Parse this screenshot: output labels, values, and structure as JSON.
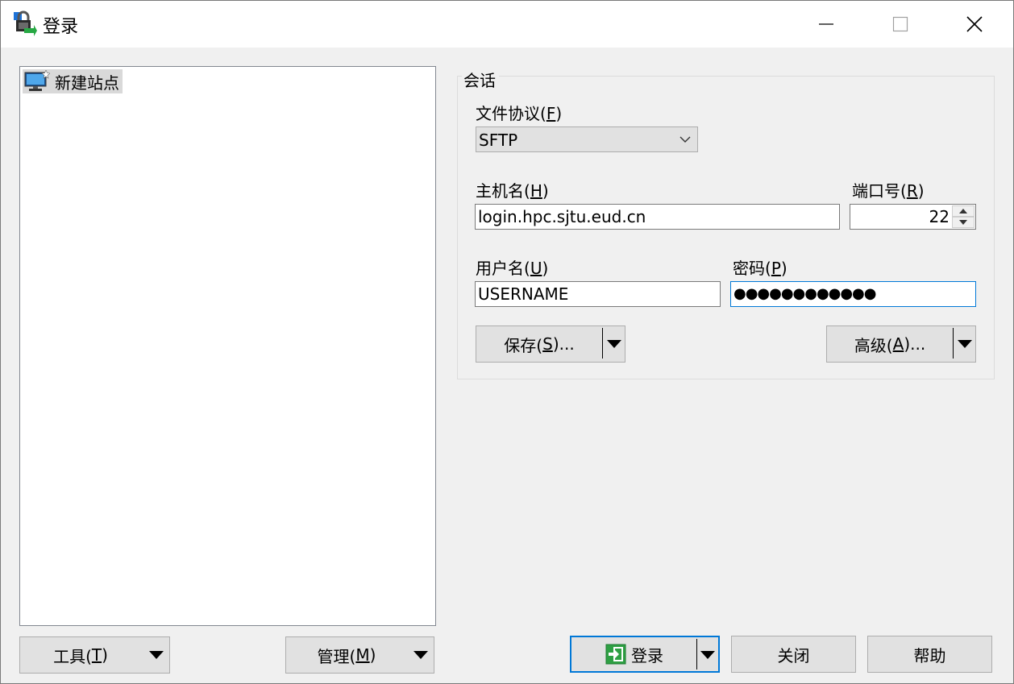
{
  "window": {
    "title": "登录",
    "minimize_icon": "minimize-icon",
    "maximize_icon": "maximize-icon",
    "close_icon": "close-icon"
  },
  "sites": {
    "items": [
      {
        "label": "新建站点",
        "icon": "new-site-monitor-icon",
        "selected": true
      }
    ]
  },
  "session": {
    "group_label": "会话",
    "protocol": {
      "label": "文件协议(",
      "mnemonic": "F",
      "label_end": ")",
      "value": "SFTP"
    },
    "host": {
      "label": "主机名(",
      "mnemonic": "H",
      "label_end": ")",
      "value": "login.hpc.sjtu.eud.cn"
    },
    "port": {
      "label": "端口号(",
      "mnemonic": "R",
      "label_end": ")",
      "value": "22"
    },
    "username": {
      "label": "用户名(",
      "mnemonic": "U",
      "label_end": ")",
      "value": "USERNAME"
    },
    "password": {
      "label": "密码(",
      "mnemonic": "P",
      "label_end": ")",
      "value": "●●●●●●●●●●●●"
    },
    "save_button": {
      "label": "保存(",
      "mnemonic": "S",
      "label_end": ")..."
    },
    "advanced_button": {
      "label": "高级(",
      "mnemonic": "A",
      "label_end": ")..."
    }
  },
  "footer": {
    "tools_button": {
      "label": "工具(",
      "mnemonic": "T",
      "label_end": ")"
    },
    "manage_button": {
      "label": "管理(",
      "mnemonic": "M",
      "label_end": ")"
    },
    "login_button": {
      "label": "登录",
      "icon": "login-arrow-icon"
    },
    "close_button": {
      "label": "关闭"
    },
    "help_button": {
      "label": "帮助"
    }
  },
  "colors": {
    "accent": "#0078d7",
    "button_face": "#e1e1e1",
    "login_icon_green": "#2ea043"
  }
}
